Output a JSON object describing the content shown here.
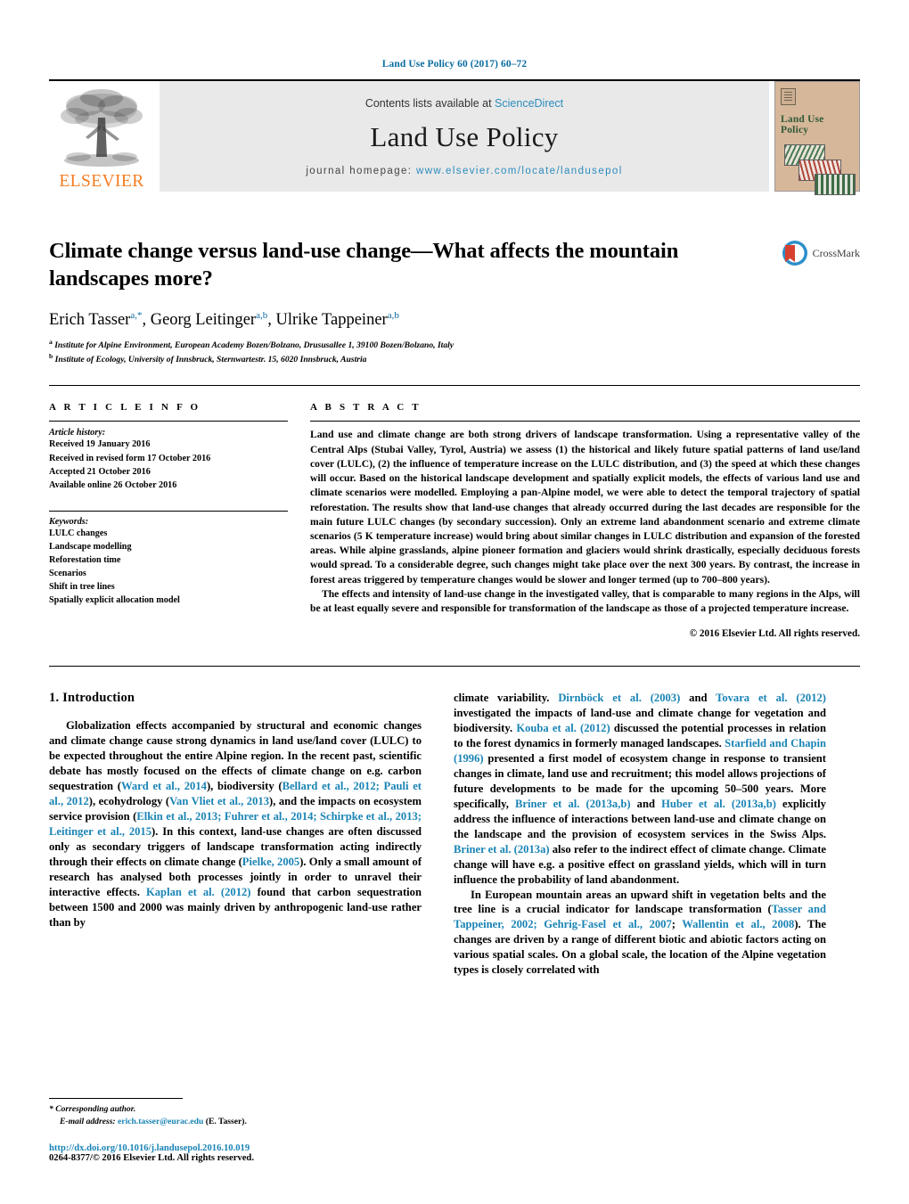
{
  "running_head": "Land Use Policy 60 (2017) 60–72",
  "masthead": {
    "publisher": "ELSEVIER",
    "contents_prefix": "Contents lists available at ",
    "contents_link": "ScienceDirect",
    "journal_title": "Land Use Policy",
    "homepage_prefix": "journal homepage: ",
    "homepage_url": "www.elsevier.com/locate/landusepol",
    "cover_title": "Land Use Policy",
    "accent_blue": "#2b8cbe",
    "elsevier_orange": "#f47c20",
    "cover_bg": "#d7b79a"
  },
  "article": {
    "title": "Climate change versus land-use change—What affects the mountain landscapes more?",
    "crossmark_label": "CrossMark",
    "authors_html": "Erich Tasser<sup class=\"ast\">a,*</sup>, Georg Leitinger<sup>a,b</sup>, Ulrike Tappeiner<sup>a,b</sup>",
    "affiliations": [
      "Institute for Alpine Environment, European Academy Bozen/Bolzano, Drususallee 1, 39100 Bozen/Bolzano, Italy",
      "Institute of Ecology, University of Innsbruck, Sternwartestr. 15, 6020 Innsbruck, Austria"
    ],
    "affiliation_marks": [
      "a",
      "b"
    ]
  },
  "article_info": {
    "label": "A R T I C L E   I N F O",
    "history_label": "Article history:",
    "history": [
      "Received 19 January 2016",
      "Received in revised form 17 October 2016",
      "Accepted 21 October 2016",
      "Available online 26 October 2016"
    ],
    "keywords_label": "Keywords:",
    "keywords": [
      "LULC changes",
      "Landscape modelling",
      "Reforestation time",
      "Scenarios",
      "Shift in tree lines",
      "Spatially explicit allocation model"
    ]
  },
  "abstract": {
    "label": "A B S T R A C T",
    "paragraph_1": "Land use and climate change are both strong drivers of landscape transformation. Using a representative valley of the Central Alps (Stubai Valley, Tyrol, Austria) we assess (1) the historical and likely future spatial patterns of land use/land cover (LULC), (2) the influence of temperature increase on the LULC distribution, and (3) the speed at which these changes will occur. Based on the historical landscape development and spatially explicit models, the effects of various land use and climate scenarios were modelled. Employing a pan-Alpine model, we were able to detect the temporal trajectory of spatial reforestation. The results show that land-use changes that already occurred during the last decades are responsible for the main future LULC changes (by secondary succession). Only an extreme land abandonment scenario and extreme climate scenarios (5 K temperature increase) would bring about similar changes in LULC distribution and expansion of the forested areas. While alpine grasslands, alpine pioneer formation and glaciers would shrink drastically, especially deciduous forests would spread. To a considerable degree, such changes might take place over the next 300 years. By contrast, the increase in forest areas triggered by temperature changes would be slower and longer termed (up to 700–800 years).",
    "paragraph_2": "The effects and intensity of land-use change in the investigated valley, that is comparable to many regions in the Alps, will be at least equally severe and responsible for transformation of the landscape as those of a projected temperature increase.",
    "copyright": "© 2016 Elsevier Ltd. All rights reserved."
  },
  "introduction": {
    "heading": "1. Introduction",
    "left_paragraph_1_html": "Globalization effects accompanied by structural and economic changes and climate change cause strong dynamics in land use/land cover (LULC) to be expected throughout the entire Alpine region. In the recent past, scientific debate has mostly focused on the effects of climate change on e.g. carbon sequestration (<span class=\"ref\">Ward et al., 2014</span>), biodiversity (<span class=\"ref\">Bellard et al., 2012; Pauli et al., 2012</span>), ecohydrology (<span class=\"ref\">Van Vliet et al., 2013</span>), and the impacts on ecosystem service provision (<span class=\"ref\">Elkin et al., 2013; Fuhrer et al., 2014; Schirpke et al., 2013; Leitinger et al., 2015</span>). In this context, land-use changes are often discussed only as secondary triggers of landscape transformation acting indirectly through their effects on climate change (<span class=\"ref\">Pielke, 2005</span>). Only a small amount of research has analysed both processes jointly in order to unravel their interactive effects. <span class=\"ref\">Kaplan et al. (2012)</span> found that carbon sequestration between 1500 and 2000 was mainly driven by anthropogenic land-use rather than by",
    "right_paragraph_1_html": "climate variability. <span class=\"ref\">Dirnböck et al. (2003)</span> and <span class=\"ref\">Tovara et al. (2012)</span> investigated the impacts of land-use and climate change for vegetation and biodiversity. <span class=\"ref\">Kouba et al. (2012)</span> discussed the potential processes in relation to the forest dynamics in formerly managed landscapes. <span class=\"ref\">Starfield and Chapin (1996)</span> presented a first model of ecosystem change in response to transient changes in climate, land use and recruitment; this model allows projections of future developments to be made for the upcoming 50–500 years. More specifically, <span class=\"ref\">Briner et al. (2013a,b)</span> and <span class=\"ref\">Huber et al. (2013a,b)</span> explicitly address the influence of interactions between land-use and climate change on the landscape and the provision of ecosystem services in the Swiss Alps. <span class=\"ref\">Briner et al. (2013a)</span> also refer to the indirect effect of climate change. Climate change will have e.g. a positive effect on grassland yields, which will in turn influence the probability of land abandonment.",
    "right_paragraph_2_html": "In European mountain areas an upward shift in vegetation belts and the tree line is a crucial indicator for landscape transformation (<span class=\"ref\">Tasser and Tappeiner, 2002; Gehrig-Fasel et al., 2007</span>; <span class=\"ref\">Wallentin et al., 2008</span>). The changes are driven by a range of different biotic and abiotic factors acting on various spatial scales. On a global scale, the location of the Alpine vegetation types is closely correlated with"
  },
  "footnote": {
    "corresponding_label": "* Corresponding author.",
    "email_label": "E-mail address:",
    "email": "erich.tasser@eurac.edu",
    "email_suffix": "(E. Tasser).",
    "doi": "http://dx.doi.org/10.1016/j.landusepol.2016.10.019",
    "issn": "0264-8377/© 2016 Elsevier Ltd. All rights reserved."
  }
}
